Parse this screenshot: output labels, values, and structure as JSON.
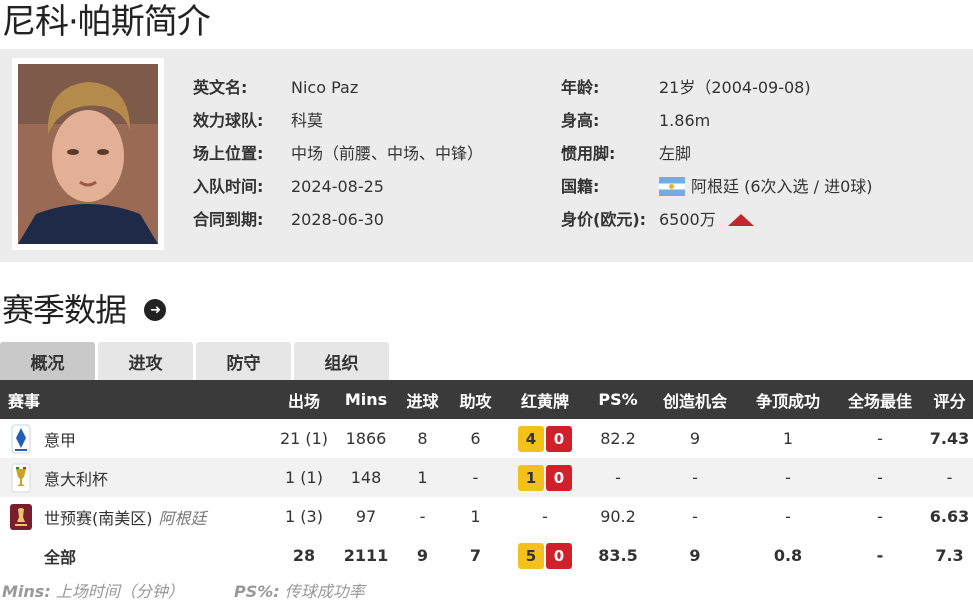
{
  "page": {
    "title": "尼科·帕斯简介"
  },
  "profile": {
    "left": [
      {
        "label": "英文名:",
        "value": "Nico Paz"
      },
      {
        "label": "效力球队:",
        "value": "科莫"
      },
      {
        "label": "场上位置:",
        "value": "中场（前腰、中场、中锋）"
      },
      {
        "label": "入队时间:",
        "value": "2024-08-25"
      },
      {
        "label": "合同到期:",
        "value": "2028-06-30"
      }
    ],
    "right": [
      {
        "label": "年龄:",
        "value": "21岁（2004-09-08)"
      },
      {
        "label": "身高:",
        "value": "1.86m"
      },
      {
        "label": "惯用脚:",
        "value": "左脚"
      },
      {
        "label": "国籍:",
        "value": "阿根廷 (6次入选 / 进0球)"
      },
      {
        "label": "身价(欧元):",
        "value": "6500万"
      }
    ]
  },
  "season": {
    "title": "赛季数据",
    "tabs": [
      "概况",
      "进攻",
      "防守",
      "组织"
    ],
    "active_tab": 0,
    "headers": [
      "赛事",
      "出场",
      "Mins",
      "进球",
      "助攻",
      "红黄牌",
      "PS%",
      "创造机会",
      "争顶成功",
      "全场最佳",
      "评分"
    ],
    "rows": [
      {
        "comp": "意甲",
        "sub": "",
        "apps": "21 (1)",
        "mins": "1866",
        "goals": "8",
        "assists": "6",
        "yellow": "4",
        "red": "0",
        "ps": "82.2",
        "chances": "9",
        "aerials": "1",
        "motm": "-",
        "rating": "7.43"
      },
      {
        "comp": "意大利杯",
        "sub": "",
        "apps": "1 (1)",
        "mins": "148",
        "goals": "1",
        "assists": "-",
        "yellow": "1",
        "red": "0",
        "ps": "-",
        "chances": "-",
        "aerials": "-",
        "motm": "-",
        "rating": "-"
      },
      {
        "comp": "世预赛(南美区)",
        "sub": "阿根廷",
        "apps": "1 (3)",
        "mins": "97",
        "goals": "-",
        "assists": "1",
        "yellow": "",
        "red": "",
        "cards_text": "-",
        "ps": "90.2",
        "chances": "-",
        "aerials": "-",
        "motm": "-",
        "rating": "6.63"
      }
    ],
    "total": {
      "comp": "全部",
      "apps": "28",
      "mins": "2111",
      "goals": "9",
      "assists": "7",
      "yellow": "5",
      "red": "0",
      "ps": "83.5",
      "chances": "9",
      "aerials": "0.8",
      "motm": "-",
      "rating": "7.3"
    }
  },
  "legend": [
    {
      "key": "Mins:",
      "text": "上场时间（分钟）"
    },
    {
      "key": "PS%:",
      "text": "传球成功率"
    }
  ],
  "colors": {
    "header_bg": "#3a3a3a",
    "rating": "#e0641c",
    "yellow_card": "#f2c21a",
    "red_card": "#d0202a",
    "trend_up": "#c4262e"
  },
  "icons": {
    "photo": "player-photo",
    "nationality": "argentina-flag-icon",
    "trend": "trend-up-icon",
    "more": "circle-arrow-right-icon",
    "league_logos": [
      "serie-a-logo-icon",
      "coppa-italia-logo-icon",
      "world-cup-qualifier-logo-icon"
    ]
  }
}
